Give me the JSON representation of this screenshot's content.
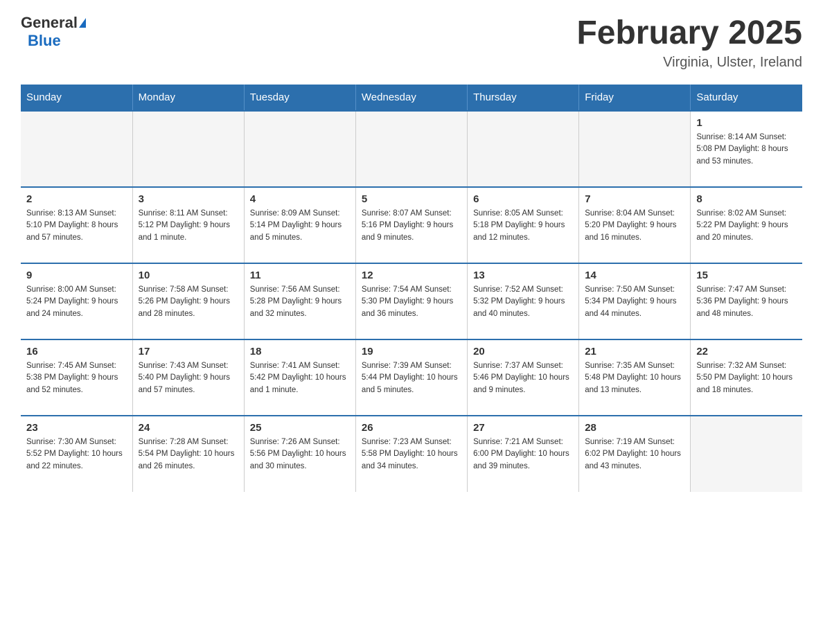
{
  "header": {
    "logo_general": "General",
    "logo_blue": "Blue",
    "month_title": "February 2025",
    "location": "Virginia, Ulster, Ireland"
  },
  "days_of_week": [
    "Sunday",
    "Monday",
    "Tuesday",
    "Wednesday",
    "Thursday",
    "Friday",
    "Saturday"
  ],
  "weeks": [
    [
      {
        "day": "",
        "info": ""
      },
      {
        "day": "",
        "info": ""
      },
      {
        "day": "",
        "info": ""
      },
      {
        "day": "",
        "info": ""
      },
      {
        "day": "",
        "info": ""
      },
      {
        "day": "",
        "info": ""
      },
      {
        "day": "1",
        "info": "Sunrise: 8:14 AM\nSunset: 5:08 PM\nDaylight: 8 hours and 53 minutes."
      }
    ],
    [
      {
        "day": "2",
        "info": "Sunrise: 8:13 AM\nSunset: 5:10 PM\nDaylight: 8 hours and 57 minutes."
      },
      {
        "day": "3",
        "info": "Sunrise: 8:11 AM\nSunset: 5:12 PM\nDaylight: 9 hours and 1 minute."
      },
      {
        "day": "4",
        "info": "Sunrise: 8:09 AM\nSunset: 5:14 PM\nDaylight: 9 hours and 5 minutes."
      },
      {
        "day": "5",
        "info": "Sunrise: 8:07 AM\nSunset: 5:16 PM\nDaylight: 9 hours and 9 minutes."
      },
      {
        "day": "6",
        "info": "Sunrise: 8:05 AM\nSunset: 5:18 PM\nDaylight: 9 hours and 12 minutes."
      },
      {
        "day": "7",
        "info": "Sunrise: 8:04 AM\nSunset: 5:20 PM\nDaylight: 9 hours and 16 minutes."
      },
      {
        "day": "8",
        "info": "Sunrise: 8:02 AM\nSunset: 5:22 PM\nDaylight: 9 hours and 20 minutes."
      }
    ],
    [
      {
        "day": "9",
        "info": "Sunrise: 8:00 AM\nSunset: 5:24 PM\nDaylight: 9 hours and 24 minutes."
      },
      {
        "day": "10",
        "info": "Sunrise: 7:58 AM\nSunset: 5:26 PM\nDaylight: 9 hours and 28 minutes."
      },
      {
        "day": "11",
        "info": "Sunrise: 7:56 AM\nSunset: 5:28 PM\nDaylight: 9 hours and 32 minutes."
      },
      {
        "day": "12",
        "info": "Sunrise: 7:54 AM\nSunset: 5:30 PM\nDaylight: 9 hours and 36 minutes."
      },
      {
        "day": "13",
        "info": "Sunrise: 7:52 AM\nSunset: 5:32 PM\nDaylight: 9 hours and 40 minutes."
      },
      {
        "day": "14",
        "info": "Sunrise: 7:50 AM\nSunset: 5:34 PM\nDaylight: 9 hours and 44 minutes."
      },
      {
        "day": "15",
        "info": "Sunrise: 7:47 AM\nSunset: 5:36 PM\nDaylight: 9 hours and 48 minutes."
      }
    ],
    [
      {
        "day": "16",
        "info": "Sunrise: 7:45 AM\nSunset: 5:38 PM\nDaylight: 9 hours and 52 minutes."
      },
      {
        "day": "17",
        "info": "Sunrise: 7:43 AM\nSunset: 5:40 PM\nDaylight: 9 hours and 57 minutes."
      },
      {
        "day": "18",
        "info": "Sunrise: 7:41 AM\nSunset: 5:42 PM\nDaylight: 10 hours and 1 minute."
      },
      {
        "day": "19",
        "info": "Sunrise: 7:39 AM\nSunset: 5:44 PM\nDaylight: 10 hours and 5 minutes."
      },
      {
        "day": "20",
        "info": "Sunrise: 7:37 AM\nSunset: 5:46 PM\nDaylight: 10 hours and 9 minutes."
      },
      {
        "day": "21",
        "info": "Sunrise: 7:35 AM\nSunset: 5:48 PM\nDaylight: 10 hours and 13 minutes."
      },
      {
        "day": "22",
        "info": "Sunrise: 7:32 AM\nSunset: 5:50 PM\nDaylight: 10 hours and 18 minutes."
      }
    ],
    [
      {
        "day": "23",
        "info": "Sunrise: 7:30 AM\nSunset: 5:52 PM\nDaylight: 10 hours and 22 minutes."
      },
      {
        "day": "24",
        "info": "Sunrise: 7:28 AM\nSunset: 5:54 PM\nDaylight: 10 hours and 26 minutes."
      },
      {
        "day": "25",
        "info": "Sunrise: 7:26 AM\nSunset: 5:56 PM\nDaylight: 10 hours and 30 minutes."
      },
      {
        "day": "26",
        "info": "Sunrise: 7:23 AM\nSunset: 5:58 PM\nDaylight: 10 hours and 34 minutes."
      },
      {
        "day": "27",
        "info": "Sunrise: 7:21 AM\nSunset: 6:00 PM\nDaylight: 10 hours and 39 minutes."
      },
      {
        "day": "28",
        "info": "Sunrise: 7:19 AM\nSunset: 6:02 PM\nDaylight: 10 hours and 43 minutes."
      },
      {
        "day": "",
        "info": ""
      }
    ]
  ]
}
